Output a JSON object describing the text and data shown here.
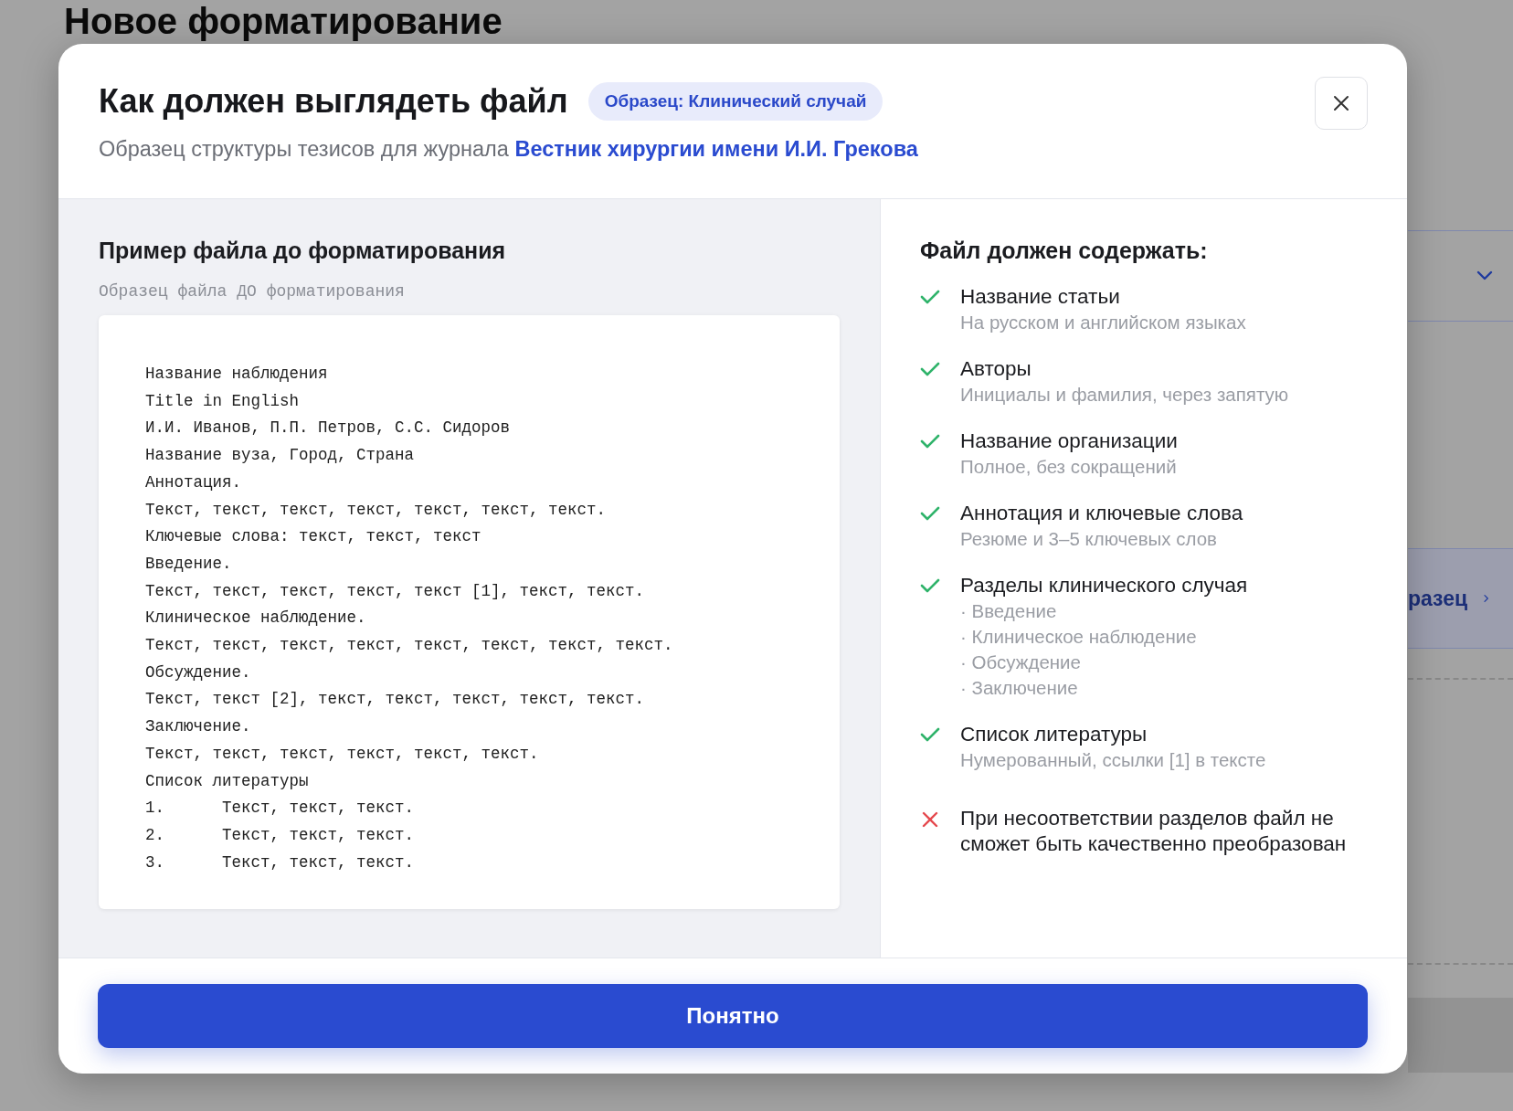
{
  "background": {
    "title": "Новое форматирование",
    "sample_button": {
      "label": "разец"
    }
  },
  "dialog": {
    "title": "Как должен выглядеть файл",
    "badge": "Образец: Клинический случай",
    "subtitle": {
      "text": "Образец структуры тезисов для журнала",
      "link": "Вестник хирургии имени И.И. Грекова"
    },
    "example": {
      "heading": "Пример файла до форматирования",
      "caption": "Образец файла ДО форматирования",
      "lines": [
        "Название наблюдения",
        "Title in English",
        "И.И. Иванов, П.П. Петров, С.С. Сидоров",
        "Название вуза, Город, Страна",
        "Аннотация.",
        "Текст, текст, текст, текст, текст, текст, текст.",
        "Ключевые слова: текст, текст, текст",
        "Введение.",
        "Текст, текст, текст, текст, текст [1], текст, текст.",
        "Клиническое наблюдение.",
        "Текст, текст, текст, текст, текст, текст, текст, текст.",
        "Обсуждение.",
        "Текст, текст [2], текст, текст, текст, текст, текст.",
        "Заключение.",
        "Текст, текст, текст, текст, текст, текст.",
        "Список литературы",
        "1.      Текст, текст, текст.",
        "2.      Текст, текст, текст.",
        "3.      Текст, текст, текст."
      ]
    },
    "requirements": {
      "heading": "Файл должен содержать:",
      "items": [
        {
          "kind": "check",
          "title": "Название статьи",
          "note": "На русском и английском языках"
        },
        {
          "kind": "check",
          "title": "Авторы",
          "note": "Инициалы и фамилия, через запятую"
        },
        {
          "kind": "check",
          "title": "Название организации",
          "note": "Полное, без сокращений"
        },
        {
          "kind": "check",
          "title": "Аннотация и ключевые слова",
          "note": "Резюме и 3–5 ключевых слов"
        },
        {
          "kind": "check",
          "title": "Разделы клинического случая",
          "bullets": [
            "· Введение",
            "· Клиническое наблюдение",
            "· Обсуждение",
            "· Заключение"
          ]
        },
        {
          "kind": "check",
          "title": "Список литературы",
          "note": "Нумерованный, ссылки [1] в тексте"
        },
        {
          "kind": "cross",
          "title": "При несоответствии разделов файл не сможет быть качественно преобразован"
        }
      ]
    },
    "confirm_button": "Понятно"
  }
}
